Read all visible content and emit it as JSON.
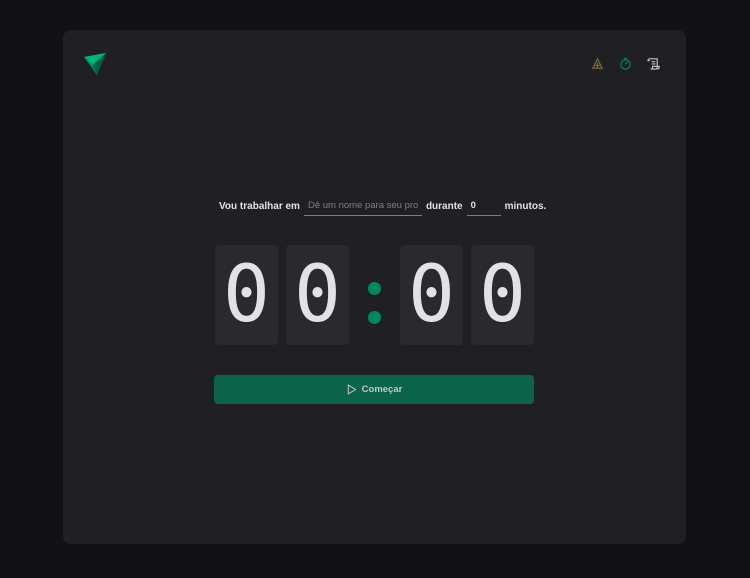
{
  "header": {
    "logo_icon": "paper-plane-logo",
    "nav": [
      {
        "name": "timer-nav",
        "icon": "timer-icon",
        "color": "#00875f"
      },
      {
        "name": "history-nav",
        "icon": "scroll-icon",
        "color": "#c4c4cc"
      }
    ],
    "theme_icon_color": "#8d6a36"
  },
  "form": {
    "label_work": "Vou trabalhar em",
    "task_placeholder": "Dê um nome para seu projeto",
    "label_during": "durante",
    "minutes_value": "0",
    "label_minutes": "minutos."
  },
  "countdown": {
    "digits": [
      "0",
      "0",
      "0",
      "0"
    ],
    "separator_color": "#00875f"
  },
  "start_button": {
    "label": "Começar",
    "icon": "play-icon",
    "color": "#0b6448"
  }
}
